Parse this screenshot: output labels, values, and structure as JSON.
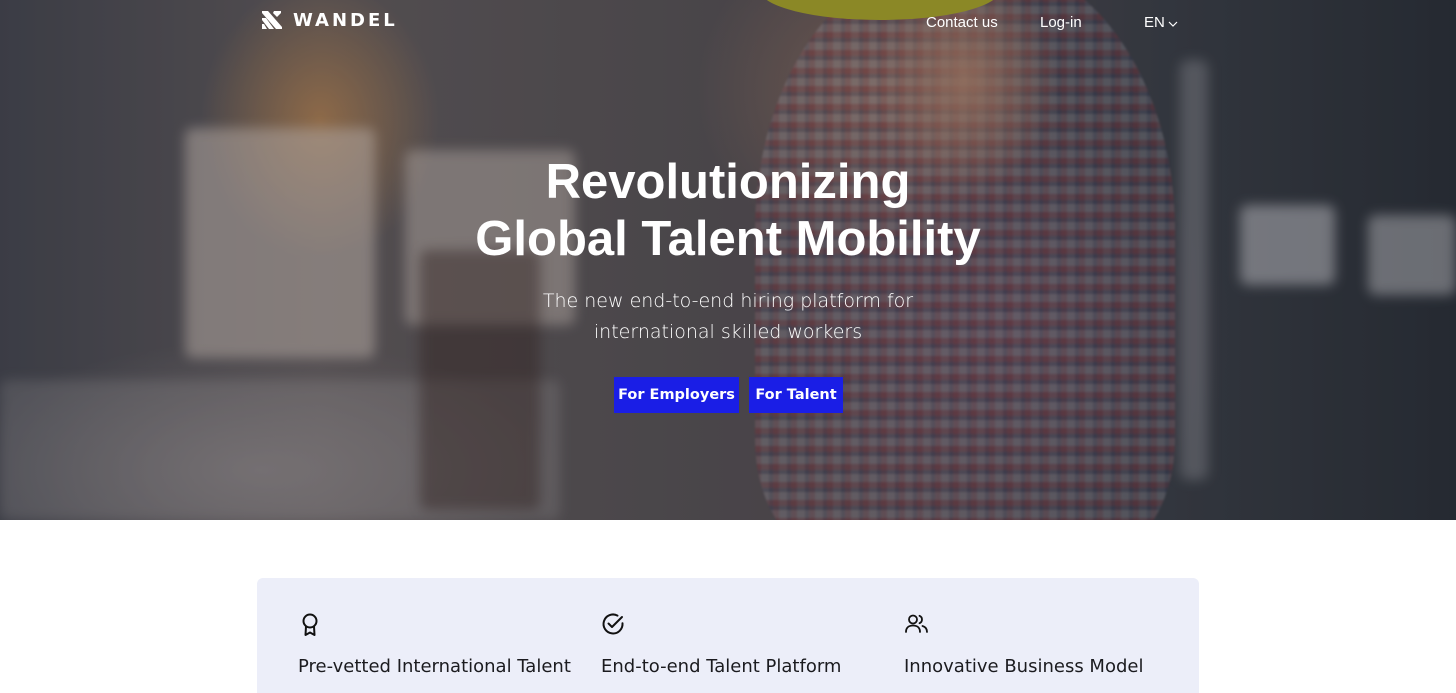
{
  "nav": {
    "brand": "WANDEL",
    "links": [
      {
        "label": "Contact us"
      },
      {
        "label": "Log-in"
      }
    ],
    "language": "EN"
  },
  "hero": {
    "title_line1": "Revolutionizing",
    "title_line2": "Global Talent Mobility",
    "subtitle_line1": "The new end-to-end hiring platform for",
    "subtitle_line2": "international skilled workers",
    "buttons": [
      {
        "label": "For Employers"
      },
      {
        "label": "For Talent"
      }
    ]
  },
  "features": [
    {
      "icon": "award-ribbon-icon",
      "label": "Pre-vetted International Talent"
    },
    {
      "icon": "check-circle-icon",
      "label": "End-to-end Talent Platform"
    },
    {
      "icon": "users-icon",
      "label": "Innovative Business Model"
    }
  ],
  "colors": {
    "accent": "#1a1ee6",
    "feature_bg": "#eceef9",
    "text_on_hero": "#ffffff"
  }
}
